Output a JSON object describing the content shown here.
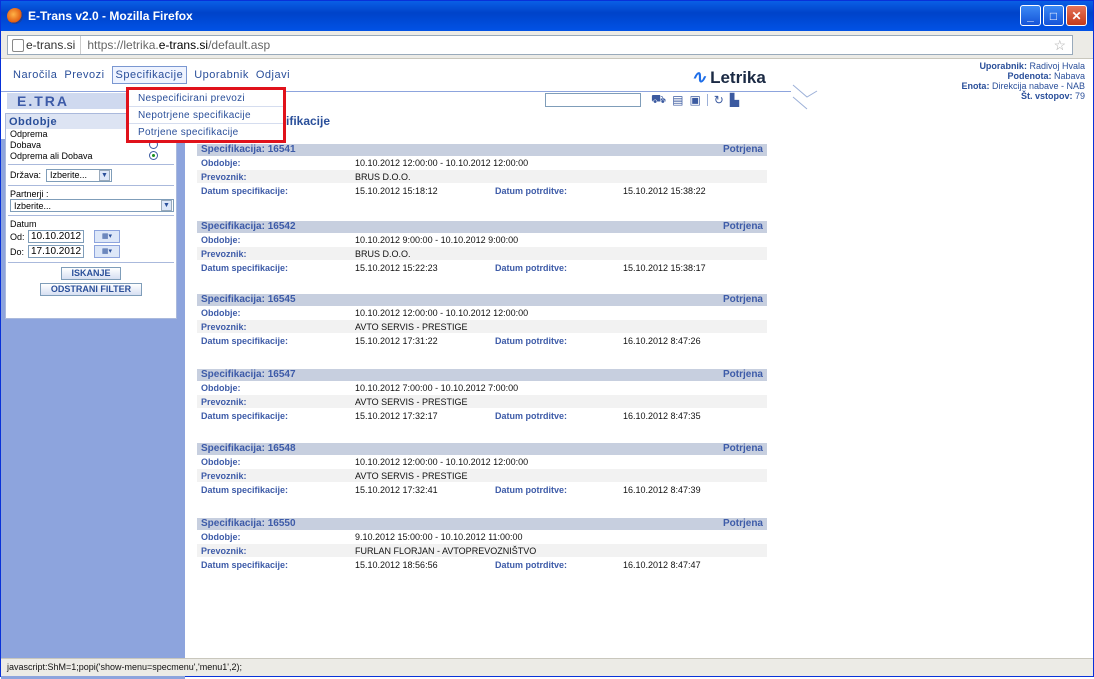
{
  "window": {
    "title": "E-Trans v2.0 - Mozilla Firefox"
  },
  "url_bar": {
    "site": "e-trans.si",
    "url_prefix": "https://letrika.",
    "url_domain": "e-trans.si",
    "url_path": "/default.asp"
  },
  "nav": {
    "items": [
      "Naročila",
      "Prevozi",
      "Specifikacije",
      "Uporabnik",
      "Odjavi"
    ],
    "active": "Specifikacije"
  },
  "brand": {
    "logo_text": "Letrika",
    "app_logo": "E.TRA"
  },
  "user": {
    "uporabnik_label": "Uporabnik:",
    "uporabnik": "Radivoj Hvala",
    "podenota_label": "Podenota:",
    "podenota": "Nabava",
    "enota_label": "Enota:",
    "enota": "Direkcija nabave - NAB",
    "vstopov_label": "Št. vstopov:",
    "vstopov": "79"
  },
  "dropdown_menu": {
    "items": [
      "Nespecificirani prevozi",
      "Nepotrjene specifikacije",
      "Potrjene specifikacije"
    ]
  },
  "page_title_fragment": "ifikacije",
  "filter": {
    "title": "Obdobje",
    "odprema": "Odprema",
    "dobava": "Dobava",
    "odprema_ali_dobava": "Odprema ali Dobava",
    "drzava_label": "Država:",
    "drzava_value": "Izberite...",
    "partnerji_label": "Partnerji :",
    "partnerji_value": "Izberite...",
    "datum_label": "Datum",
    "od_label": "Od:",
    "od_value": "10.10.2012",
    "do_label": "Do:",
    "do_value": "17.10.2012",
    "isci_button": "ISKANJE",
    "odstrani_button": "ODSTRANI FILTER"
  },
  "labels": {
    "specifikacija": "Specifikacija:",
    "obdobje": "Obdobje:",
    "prevoznik": "Prevoznik:",
    "datum_specifikacije": "Datum specifikacije:",
    "datum_potrditve": "Datum potrditve:"
  },
  "specs": [
    {
      "header": "Specifikacija: 16541",
      "status": "Potrjena",
      "obdobje": "10.10.2012 12:00:00 - 10.10.2012 12:00:00",
      "prevoznik": "BRUS D.O.O.",
      "datum_spec": "15.10.2012 15:18:12",
      "datum_potrditve": "15.10.2012 15:38:22"
    },
    {
      "header": "Specifikacija: 16542",
      "status": "Potrjena",
      "obdobje": "10.10.2012 9:00:00 - 10.10.2012 9:00:00",
      "prevoznik": "BRUS D.O.O.",
      "datum_spec": "15.10.2012 15:22:23",
      "datum_potrditve": "15.10.2012 15:38:17"
    },
    {
      "header": "Specifikacija: 16545",
      "status": "Potrjena",
      "obdobje": "10.10.2012 12:00:00 - 10.10.2012 12:00:00",
      "prevoznik": "AVTO SERVIS - PRESTIGE",
      "datum_spec": "15.10.2012 17:31:22",
      "datum_potrditve": "16.10.2012 8:47:26"
    },
    {
      "header": "Specifikacija: 16547",
      "status": "Potrjena",
      "obdobje": "10.10.2012 7:00:00 - 10.10.2012 7:00:00",
      "prevoznik": "AVTO SERVIS - PRESTIGE",
      "datum_spec": "15.10.2012 17:32:17",
      "datum_potrditve": "16.10.2012 8:47:35"
    },
    {
      "header": "Specifikacija: 16548",
      "status": "Potrjena",
      "obdobje": "10.10.2012 12:00:00 - 10.10.2012 12:00:00",
      "prevoznik": "AVTO SERVIS - PRESTIGE",
      "datum_spec": "15.10.2012 17:32:41",
      "datum_potrditve": "16.10.2012 8:47:39"
    },
    {
      "header": "Specifikacija: 16550",
      "status": "Potrjena",
      "obdobje": "9.10.2012 15:00:00 - 10.10.2012 11:00:00",
      "prevoznik": "FURLAN FLORJAN - AVTOPREVOZNIŠTVO",
      "datum_spec": "15.10.2012 18:56:56",
      "datum_potrditve": "16.10.2012 8:47:47"
    }
  ],
  "statusbar": {
    "text": "javascript:ShM=1;popi('show-menu=specmenu','menu1',2);"
  },
  "colors": {
    "accent": "#2a4f9a",
    "sidebar": "#8da4dd",
    "highlight": "#e0121b"
  }
}
